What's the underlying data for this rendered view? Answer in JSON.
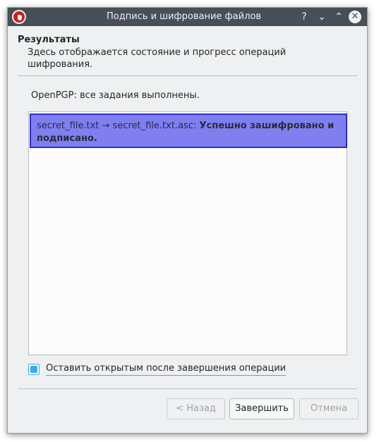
{
  "window": {
    "title": "Подпись и шифрование файлов",
    "help_glyph": "?",
    "minimize_glyph": "⌄",
    "maximize_glyph": "⌃",
    "close_glyph": "✕"
  },
  "header": {
    "title": "Результаты",
    "subtitle": "Здесь отображается состояние и прогресс операций шифрования."
  },
  "status": {
    "text": "OpenPGP: все задания выполнены."
  },
  "results_list": {
    "items": [
      {
        "files": "secret_file.txt → secret_file.txt.asc: ",
        "result": "Успешно зашифровано и подписано."
      }
    ]
  },
  "options": {
    "keep_open_label": "Оставить открытым после завершения операции",
    "keep_open_checked": true
  },
  "buttons": {
    "back_label": "< Назад",
    "finish_label": "Завершить",
    "cancel_label": "Отмена"
  },
  "colors": {
    "titlebar": "#475057",
    "window_bg": "#eff0f1",
    "selection": "#7f7ff0",
    "accent": "#3daee9"
  },
  "icons": {
    "app": "kleopatra-icon"
  }
}
